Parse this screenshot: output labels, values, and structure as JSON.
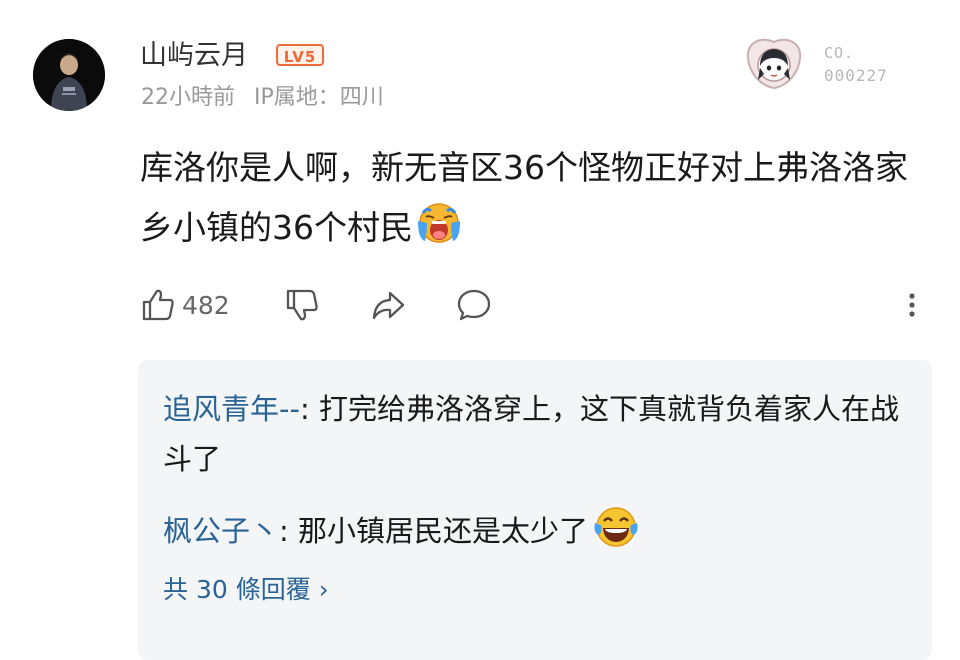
{
  "comment": {
    "username": "山屿云月",
    "level_badge": "LV5",
    "timestamp": "22小時前",
    "ip_location": "IP属地：四川",
    "collectible_label": "CO.",
    "collectible_number": "000227",
    "text": "库洛你是人啊，新无音区36个怪物正好对上弗洛洛家乡小镇的36个村民",
    "text_emoji": "crying-emoji",
    "likes": "482"
  },
  "replies": [
    {
      "user": "追风青年--",
      "text": "打完给弗洛洛穿上，这下真就背负着家人在战斗了"
    },
    {
      "user": "枫公子丶",
      "text": "那小镇居民还是太少了",
      "emoji": "laughing-tears-emoji"
    }
  ],
  "view_more": "共 30 條回覆 ›",
  "colors": {
    "link_blue": "#2a6496",
    "badge_orange": "#ee6a3a",
    "reply_background": "#f4f5f7"
  }
}
